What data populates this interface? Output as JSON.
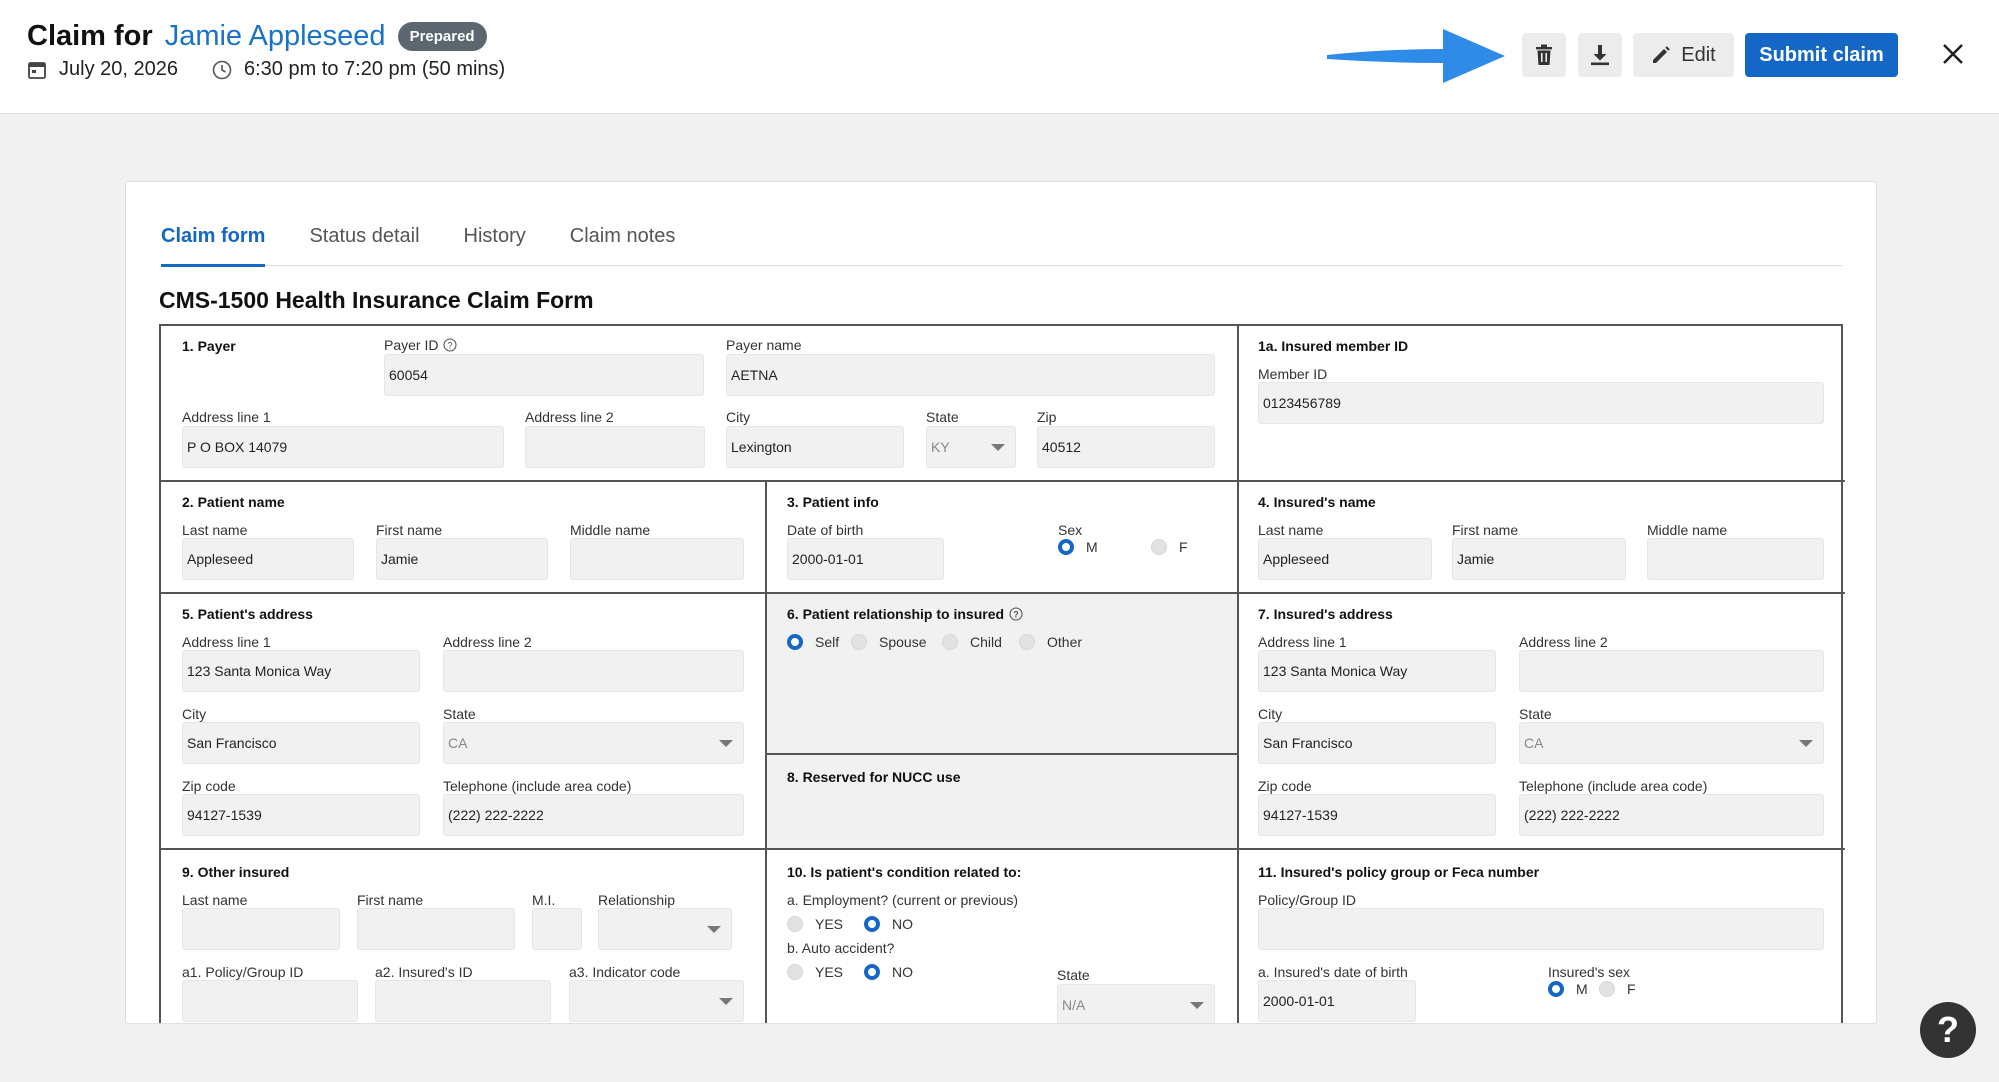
{
  "header": {
    "title_prefix": "Claim for",
    "patient_name": "Jamie Appleseed",
    "status_badge": "Prepared",
    "date": "July 20, 2026",
    "time": "6:30 pm to 7:20 pm (50 mins)",
    "edit_label": "Edit",
    "submit_label": "Submit claim",
    "accent_color": "#1467c4",
    "icons": [
      "calendar-icon",
      "clock-icon",
      "trash-icon",
      "download-icon",
      "pencil-icon",
      "close-icon",
      "arrow-icon",
      "help-icon"
    ]
  },
  "tabs": [
    "Claim form",
    "Status detail",
    "History",
    "Claim notes"
  ],
  "form_title": "CMS-1500 Health Insurance Claim Form",
  "payer": {
    "title": "1. Payer",
    "payer_id_label": "Payer ID",
    "payer_id": "60054",
    "payer_name_label": "Payer name",
    "payer_name": "AETNA",
    "address1_label": "Address line 1",
    "address1": "P O BOX 14079",
    "address2_label": "Address line 2",
    "address2": "",
    "city_label": "City",
    "city": "Lexington",
    "state_label": "State",
    "state": "KY",
    "zip_label": "Zip",
    "zip": "40512"
  },
  "insured_member": {
    "title": "1a. Insured member ID",
    "member_id_label": "Member ID",
    "member_id": "0123456789"
  },
  "patient_name": {
    "title": "2. Patient name",
    "last_label": "Last name",
    "last": "Appleseed",
    "first_label": "First name",
    "first": "Jamie",
    "middle_label": "Middle name",
    "middle": ""
  },
  "patient_info": {
    "title": "3. Patient info",
    "dob_label": "Date of birth",
    "dob": "2000-01-01",
    "sex_label": "Sex",
    "sex_m": "M",
    "sex_f": "F",
    "selected": "M"
  },
  "insured_name": {
    "title": "4. Insured's name",
    "last_label": "Last name",
    "last": "Appleseed",
    "first_label": "First name",
    "first": "Jamie",
    "middle_label": "Middle name",
    "middle": ""
  },
  "patient_address": {
    "title": "5. Patient's address",
    "address1_label": "Address line 1",
    "address1": "123 Santa Monica Way",
    "address2_label": "Address line 2",
    "address2": "",
    "city_label": "City",
    "city": "San Francisco",
    "state_label": "State",
    "state": "CA",
    "zip_label": "Zip code",
    "zip": "94127-1539",
    "phone_label": "Telephone (include area code)",
    "phone": "(222) 222-2222"
  },
  "relationship": {
    "title": "6. Patient relationship to insured",
    "options": [
      "Self",
      "Spouse",
      "Child",
      "Other"
    ],
    "selected": "Self"
  },
  "reserved": {
    "title": "8. Reserved for NUCC use"
  },
  "insured_address": {
    "title": "7. Insured's address",
    "address1_label": "Address line 1",
    "address1": "123 Santa Monica Way",
    "address2_label": "Address line 2",
    "address2": "",
    "city_label": "City",
    "city": "San Francisco",
    "state_label": "State",
    "state": "CA",
    "zip_label": "Zip code",
    "zip": "94127-1539",
    "phone_label": "Telephone (include area code)",
    "phone": "(222) 222-2222"
  },
  "other_insured": {
    "title": "9. Other insured",
    "last_label": "Last name",
    "first_label": "First name",
    "mi_label": "M.I.",
    "relationship_label": "Relationship",
    "policy_label": "a1. Policy/Group ID",
    "insured_id_label": "a2. Insured's ID",
    "indicator_label": "a3. Indicator code"
  },
  "condition": {
    "title": "10. Is patient's condition related to:",
    "employment_label": "a. Employment? (current or previous)",
    "auto_label": "b. Auto accident?",
    "yes": "YES",
    "no": "NO",
    "employment_selected": "NO",
    "auto_selected": "NO",
    "state_label": "State",
    "state": "N/A"
  },
  "policy_group": {
    "title": "11. Insured's policy group or Feca number",
    "policy_label": "Policy/Group ID",
    "policy": "",
    "dob_label": "a. Insured's date of birth",
    "dob": "2000-01-01",
    "sex_label": "Insured's sex",
    "sex_m": "M",
    "sex_f": "F",
    "selected": "M"
  },
  "help": "?"
}
